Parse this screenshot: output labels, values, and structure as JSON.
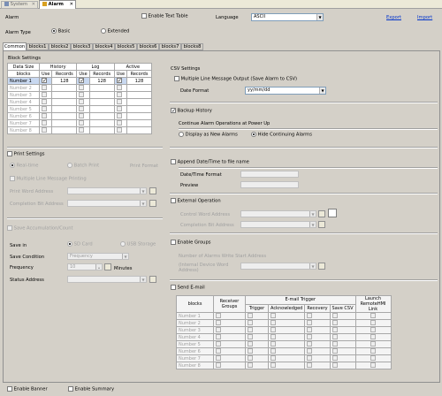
{
  "window": {
    "tabs": [
      {
        "label": "System",
        "active": false
      },
      {
        "label": "Alarm",
        "active": true
      }
    ]
  },
  "header": {
    "title": "Alarm",
    "enable_text_table": "Enable Text Table",
    "language_label": "Language",
    "language_value": "ASCII",
    "export": "Export",
    "import": "Import",
    "alarm_type_label": "Alarm Type",
    "type_basic": "Basic",
    "type_extended": "Extended"
  },
  "tabs": [
    "Common",
    "blocks1",
    "blocks2",
    "blocks3",
    "blocks4",
    "blocks5",
    "blocks6",
    "blocks7",
    "blocks8"
  ],
  "block_settings": {
    "title": "Block Settings",
    "h_data_size": "Data Size",
    "h_history": "History",
    "h_log": "Log",
    "h_active": "Active",
    "h_blocks": "blocks",
    "h_use": "Use",
    "h_records": "Records",
    "rows": [
      {
        "name": "Number 1",
        "hist_use": true,
        "hist_rec": "128",
        "log_use": true,
        "log_rec": "128",
        "act_use": true,
        "act_rec": "128"
      },
      {
        "name": "Number 2"
      },
      {
        "name": "Number 3"
      },
      {
        "name": "Number 4"
      },
      {
        "name": "Number 5"
      },
      {
        "name": "Number 6"
      },
      {
        "name": "Number 7"
      },
      {
        "name": "Number 8"
      }
    ]
  },
  "csv": {
    "title": "CSV Settings",
    "multiple_line": "Multiple Line Message Output (Save Alarm to CSV)",
    "date_format_label": "Date Format",
    "date_format_value": "yy/mm/dd"
  },
  "backup": {
    "label": "Backup History",
    "continue_label": "Continue Alarm Operations at Power Up",
    "display_new": "Display as New Alarms",
    "hide_continuing": "Hide Continuing Alarms"
  },
  "print": {
    "label": "Print Settings",
    "real_time": "Real-time",
    "batch_print": "Batch Print",
    "print_format": "Print Format",
    "multiple_line": "Multiple Line Message Printing",
    "word_address": "Print Word Address",
    "completion_bit": "Completion Bit Address"
  },
  "append": {
    "label": "Append Date/Time to file name",
    "format_label": "Date/Time Format",
    "preview_label": "Preview"
  },
  "external": {
    "label": "External Operation",
    "control_word": "Control Word Address",
    "completion_bit": "Completion Bit Address"
  },
  "save_accum": {
    "label": "Save Accumulation/Count",
    "save_in": "Save in",
    "sd_card": "SD Card",
    "usb_storage": "USB Storage",
    "save_condition": "Save Condition",
    "condition_value": "Frequency",
    "frequency": "Frequency",
    "freq_value": "10",
    "minutes": "Minutes",
    "status_address": "Status Address"
  },
  "groups": {
    "label": "Enable Groups",
    "num_alarms": "Number of Alarms Write Start Address",
    "internal_addr": "(Internal Device Word Address)"
  },
  "email": {
    "label": "Send E-mail",
    "h_blocks": "blocks",
    "h_receiver": "Receiver Groups",
    "h_trigger_group": "E-mail Trigger",
    "h_trigger": "Trigger",
    "h_ack": "Acknowledged",
    "h_recovery": "Recovery",
    "h_save_csv": "Save CSV",
    "h_launch": "Launch RemoteHMI Link",
    "rows": [
      "Number 1",
      "Number 2",
      "Number 3",
      "Number 4",
      "Number 5",
      "Number 6",
      "Number 7",
      "Number 8"
    ]
  },
  "footer": {
    "enable_banner": "Enable Banner",
    "enable_summary": "Enable Summary"
  }
}
